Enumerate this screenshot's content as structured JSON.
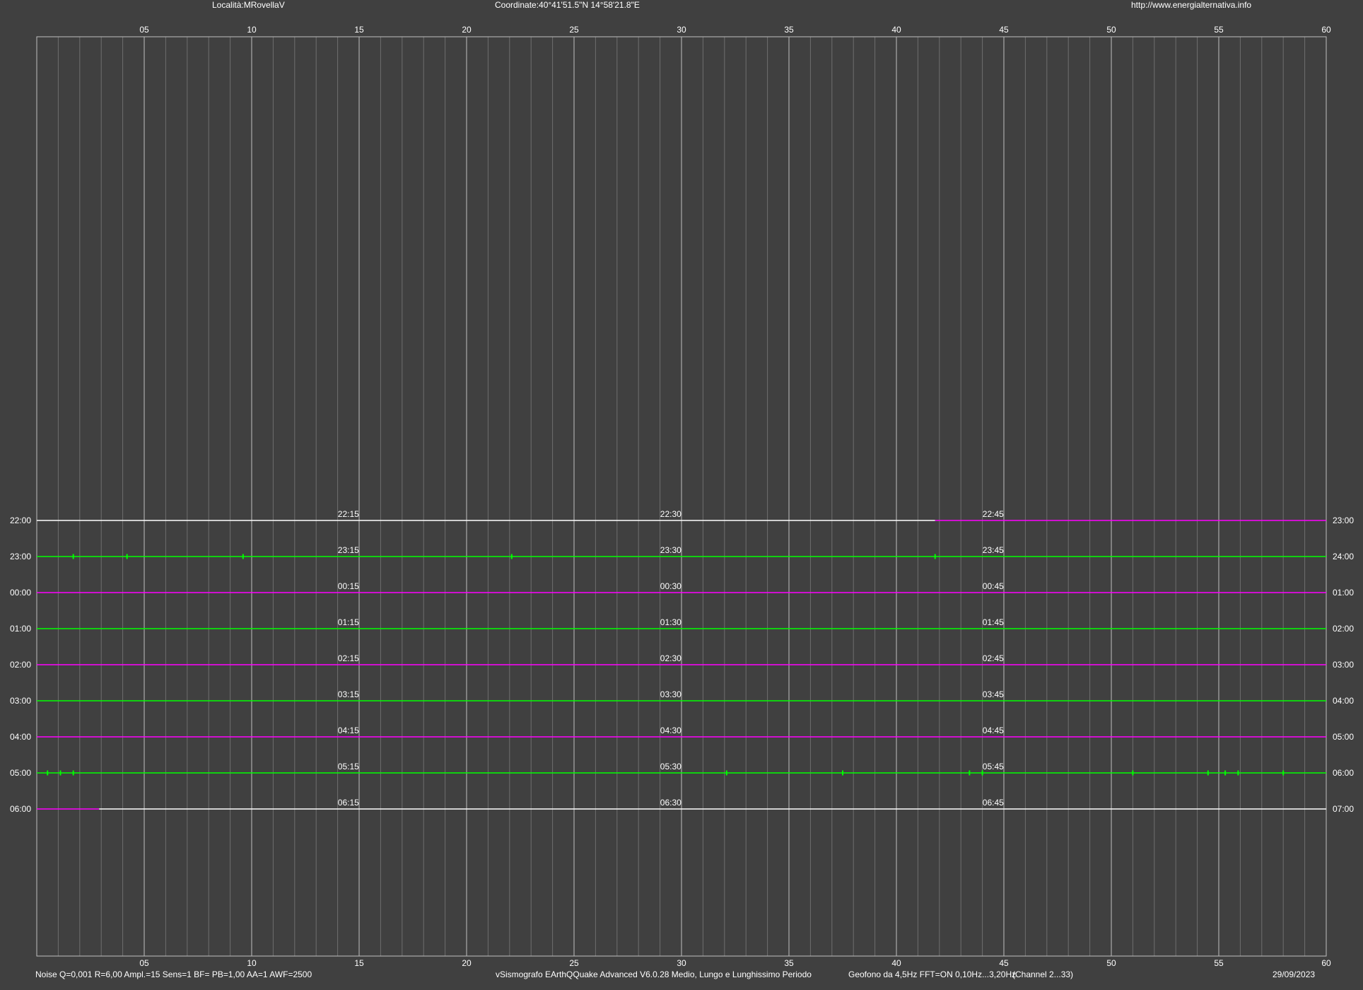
{
  "header": {
    "locality": "Località:MRovellaV",
    "coordinates": "Coordinate:40°41'51.5\"N 14°58'21.8\"E",
    "website": "http://www.energialternativa.info"
  },
  "footer": {
    "settings": "Noise Q=0,001 R=6,00 Ampl.=15 Sens=1 BF= PB=1,00 AA=1 AWF=2500",
    "software": "vSismografo  EArthQQuake Advanced V6.0.28  Medio, Lungo e Lunghissimo Periodo",
    "sensor": "Geofono da 4,5Hz FFT=ON 0,10Hz...3,20Hz",
    "channel": "(Channel 2...33)",
    "date": "29/09/2023"
  },
  "colors": {
    "background": "#404040",
    "grid_major": "#bfbfbf",
    "grid_minor": "#6e6e6e",
    "trace_green": "#00ff00",
    "trace_magenta": "#ff00ff",
    "trace_white": "#ffffff"
  },
  "chart_data": {
    "type": "line",
    "title": "",
    "x_axis": {
      "min": 0,
      "max": 60,
      "minor_step": 1,
      "tick_labels": [
        "05",
        "10",
        "15",
        "20",
        "25",
        "30",
        "35",
        "40",
        "45",
        "50",
        "55",
        "60"
      ],
      "tick_values": [
        5,
        10,
        15,
        20,
        25,
        30,
        35,
        40,
        45,
        50,
        55,
        60
      ]
    },
    "rows": [
      {
        "left": "22:00",
        "right": "23:00",
        "marks": [
          "22:15",
          "22:30",
          "22:45"
        ],
        "segments": [
          {
            "from": 0,
            "to": 41.8,
            "color": "white"
          },
          {
            "from": 41.8,
            "to": 60,
            "color": "magenta"
          }
        ],
        "spikes": []
      },
      {
        "left": "23:00",
        "right": "24:00",
        "marks": [
          "23:15",
          "23:30",
          "23:45"
        ],
        "segments": [
          {
            "from": 0,
            "to": 60,
            "color": "green"
          }
        ],
        "spikes": [
          1.7,
          4.2,
          9.6,
          22.1,
          41.8
        ]
      },
      {
        "left": "00:00",
        "right": "01:00",
        "marks": [
          "00:15",
          "00:30",
          "00:45"
        ],
        "segments": [
          {
            "from": 0,
            "to": 60,
            "color": "magenta"
          }
        ],
        "spikes": []
      },
      {
        "left": "01:00",
        "right": "02:00",
        "marks": [
          "01:15",
          "01:30",
          "01:45"
        ],
        "segments": [
          {
            "from": 0,
            "to": 60,
            "color": "green"
          }
        ],
        "spikes": []
      },
      {
        "left": "02:00",
        "right": "03:00",
        "marks": [
          "02:15",
          "02:30",
          "02:45"
        ],
        "segments": [
          {
            "from": 0,
            "to": 60,
            "color": "magenta"
          }
        ],
        "spikes": []
      },
      {
        "left": "03:00",
        "right": "04:00",
        "marks": [
          "03:15",
          "03:30",
          "03:45"
        ],
        "segments": [
          {
            "from": 0,
            "to": 60,
            "color": "green"
          }
        ],
        "spikes": []
      },
      {
        "left": "04:00",
        "right": "05:00",
        "marks": [
          "04:15",
          "04:30",
          "04:45"
        ],
        "segments": [
          {
            "from": 0,
            "to": 60,
            "color": "magenta"
          }
        ],
        "spikes": []
      },
      {
        "left": "05:00",
        "right": "06:00",
        "marks": [
          "05:15",
          "05:30",
          "05:45"
        ],
        "segments": [
          {
            "from": 0,
            "to": 60,
            "color": "green"
          }
        ],
        "spikes": [
          0.5,
          1.1,
          1.7,
          32.1,
          37.5,
          43.4,
          44.0,
          51.0,
          54.5,
          55.3,
          55.9,
          58.0
        ]
      },
      {
        "left": "06:00",
        "right": "07:00",
        "marks": [
          "06:15",
          "06:30",
          "06:45"
        ],
        "segments": [
          {
            "from": 0,
            "to": 2.9,
            "color": "magenta"
          },
          {
            "from": 2.9,
            "to": 60,
            "color": "white"
          }
        ],
        "spikes": []
      }
    ]
  }
}
